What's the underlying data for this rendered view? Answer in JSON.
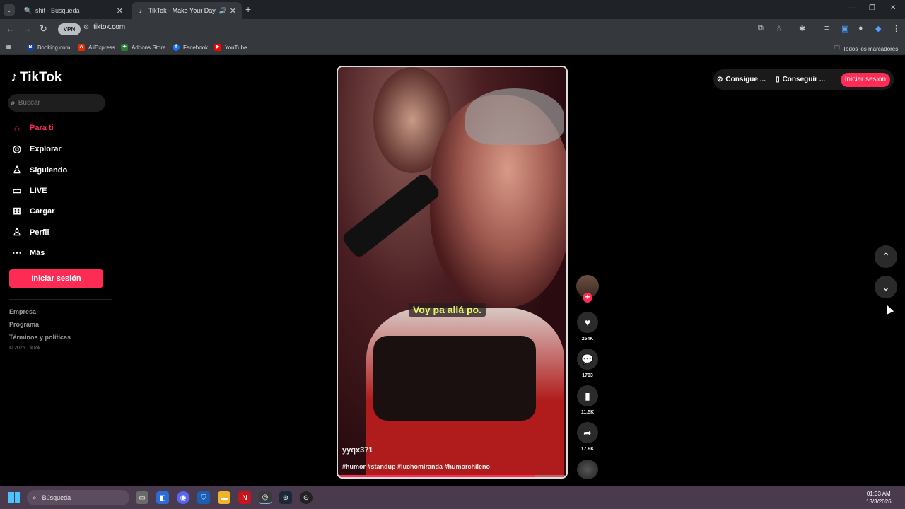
{
  "browser": {
    "tabs": [
      {
        "title": "shit - Búsqueda",
        "active": false
      },
      {
        "title": "TikTok - Make Your Day",
        "active": true
      }
    ],
    "url": "tiktok.com",
    "vpn_label": "VPN",
    "bookmarks": [
      "Booking.com",
      "AliExpress",
      "Addons Store",
      "Facebook",
      "YouTube"
    ],
    "all_bookmarks": "Todos los marcadores"
  },
  "tiktok": {
    "logo": "TikTok",
    "search_placeholder": "Buscar",
    "nav": [
      {
        "label": "Para ti",
        "icon": "home-icon",
        "active": true
      },
      {
        "label": "Explorar",
        "icon": "compass-icon",
        "active": false
      },
      {
        "label": "Siguiendo",
        "icon": "following-icon",
        "active": false
      },
      {
        "label": "LIVE",
        "icon": "live-icon",
        "active": false
      },
      {
        "label": "Cargar",
        "icon": "upload-icon",
        "active": false
      },
      {
        "label": "Perfil",
        "icon": "profile-icon",
        "active": false
      },
      {
        "label": "Más",
        "icon": "more-icon",
        "active": false
      }
    ],
    "login_button": "Iniciar sesión",
    "footer_links": [
      "Empresa",
      "Programa",
      "Términos y políticas"
    ],
    "copyright": "© 2026 TikTok",
    "top_buttons": {
      "get_coins": "Consigue ...",
      "get_app": "Conseguir ...",
      "login": "Iniciar sesión"
    },
    "video": {
      "caption": "Voy pa allá po.",
      "username": "yyqx371",
      "hashtags": "#humor #standup #luchomiranda #humorchileno",
      "progress": 0.86
    },
    "actions": {
      "likes": "254K",
      "comments": "1703",
      "saves": "11.5K",
      "shares": "17.9K"
    }
  },
  "taskbar": {
    "search_label": "Búsqueda",
    "time": "01:33 AM",
    "date": "13/3/2026"
  },
  "colors": {
    "accent": "#fe2c55",
    "caption_text": "#e8f26b"
  }
}
